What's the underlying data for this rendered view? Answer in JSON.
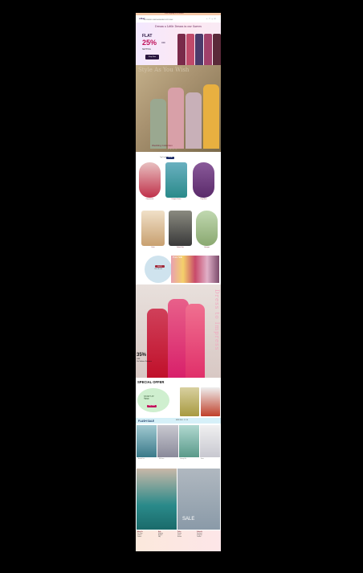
{
  "topbar": {
    "text": "Free shipping on all orders"
  },
  "header": {
    "logo": "sitar",
    "icons": "⌕ ♡ ⚲ ◱",
    "nav": "NEW  SAREES  LEHENGA  SALWAR  KURTIS  SALE"
  },
  "promo": {
    "heading": "Dream a Little Dream in our Sarees",
    "flat": "FLAT",
    "pct": "25%",
    "off": "OFF",
    "shop": "NETTING",
    "button": "Shop Now"
  },
  "hero2": {
    "overlay": "Style As You Wish",
    "footer": "Wedding Collection",
    "dots": "• • • •"
  },
  "categories": {
    "title": "Top Trends",
    "view_button": "View All",
    "items": [
      {
        "label": "Kanjeevaram"
      },
      {
        "label": "Designer Sarees"
      },
      {
        "label": "Party Wear"
      },
      {
        "label": "Kurtis"
      },
      {
        "label": "Salwar Suits"
      },
      {
        "label": "Lehengas"
      }
    ]
  },
  "mid": {
    "pill": "SHOP",
    "text": "Latest Arrivals",
    "rack_caption": "Pure Silk"
  },
  "dress": {
    "vertical_text": "Dress to Impress",
    "pct": "35%",
    "off_line": "OFF",
    "sub": "On Salwar Kameez"
  },
  "special": {
    "heading": "SPECIAL OFFER",
    "start": "START AT",
    "price": "₹999",
    "button": "Buy Now"
  },
  "flash": {
    "title": "FLASH SALE",
    "right": "ENDS IN 05 : 12 : 36",
    "prods": [
      {
        "label": "Anarkali Suit"
      },
      {
        "label": "Silk Saree"
      },
      {
        "label": "Lehenga Set"
      },
      {
        "label": "Gown"
      }
    ]
  },
  "bottom": {
    "sale": "SALE"
  },
  "footer": {
    "c1_title": "About Us",
    "c1_lines": [
      "Our Story",
      "Careers",
      "Contact"
    ],
    "c2_title": "Help",
    "c2_lines": [
      "Shipping",
      "Returns",
      "FAQ"
    ],
    "c3_title": "Policy",
    "c3_lines": [
      "Privacy",
      "Terms",
      "Refund"
    ],
    "c4_title": "Follow Us",
    "c4_lines": [
      "Facebook",
      "Instagram",
      "Youtube"
    ]
  }
}
